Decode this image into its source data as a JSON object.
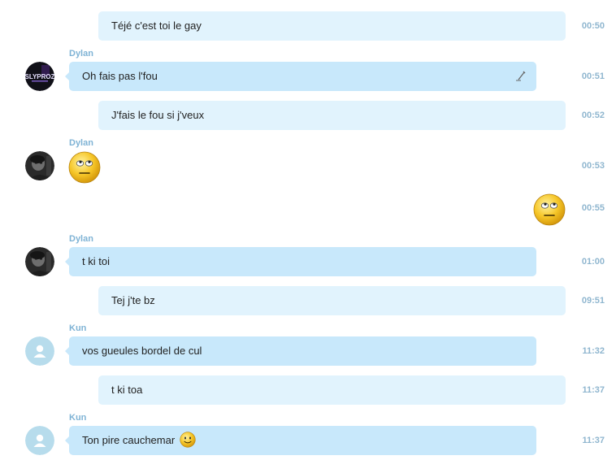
{
  "messages": [
    {
      "text": "Téjé c'est toi le gay",
      "time": "00:50"
    },
    {
      "sender": "Dylan",
      "avatar": "slyproz-logo-avatar",
      "avatar_text": "SLYPROZ",
      "text": "Oh fais pas l'fou",
      "time": "00:51",
      "edited_icon": "pencil-icon"
    },
    {
      "text": "J'fais le fou si j'veux",
      "time": "00:52"
    },
    {
      "sender": "Dylan",
      "avatar": "dark-portrait-avatar",
      "emoji": "eye-roll-emoji",
      "time": "00:53"
    },
    {
      "emoji": "eye-roll-emoji",
      "time": "00:55"
    },
    {
      "sender": "Dylan",
      "avatar": "dark-portrait-avatar",
      "text": "t ki toi",
      "time": "01:00"
    },
    {
      "text": "Tej j'te bz",
      "time": "09:51"
    },
    {
      "sender": "Kun",
      "avatar": "default-person-avatar",
      "text": "vos gueules bordel de cul",
      "time": "11:32"
    },
    {
      "text": "t ki toa",
      "time": "11:37"
    },
    {
      "sender": "Kun",
      "avatar": "default-person-avatar",
      "text": "Ton pire cauchemar",
      "emoji": "smile-emoji",
      "time": "11:37"
    }
  ],
  "colors": {
    "incoming_bubble": "#c8e8fb",
    "outgoing_bubble": "#e1f3fd",
    "sender_name": "#7fb3d5",
    "timestamp": "#8fb6cf",
    "default_avatar_bg": "#b7dcec"
  }
}
